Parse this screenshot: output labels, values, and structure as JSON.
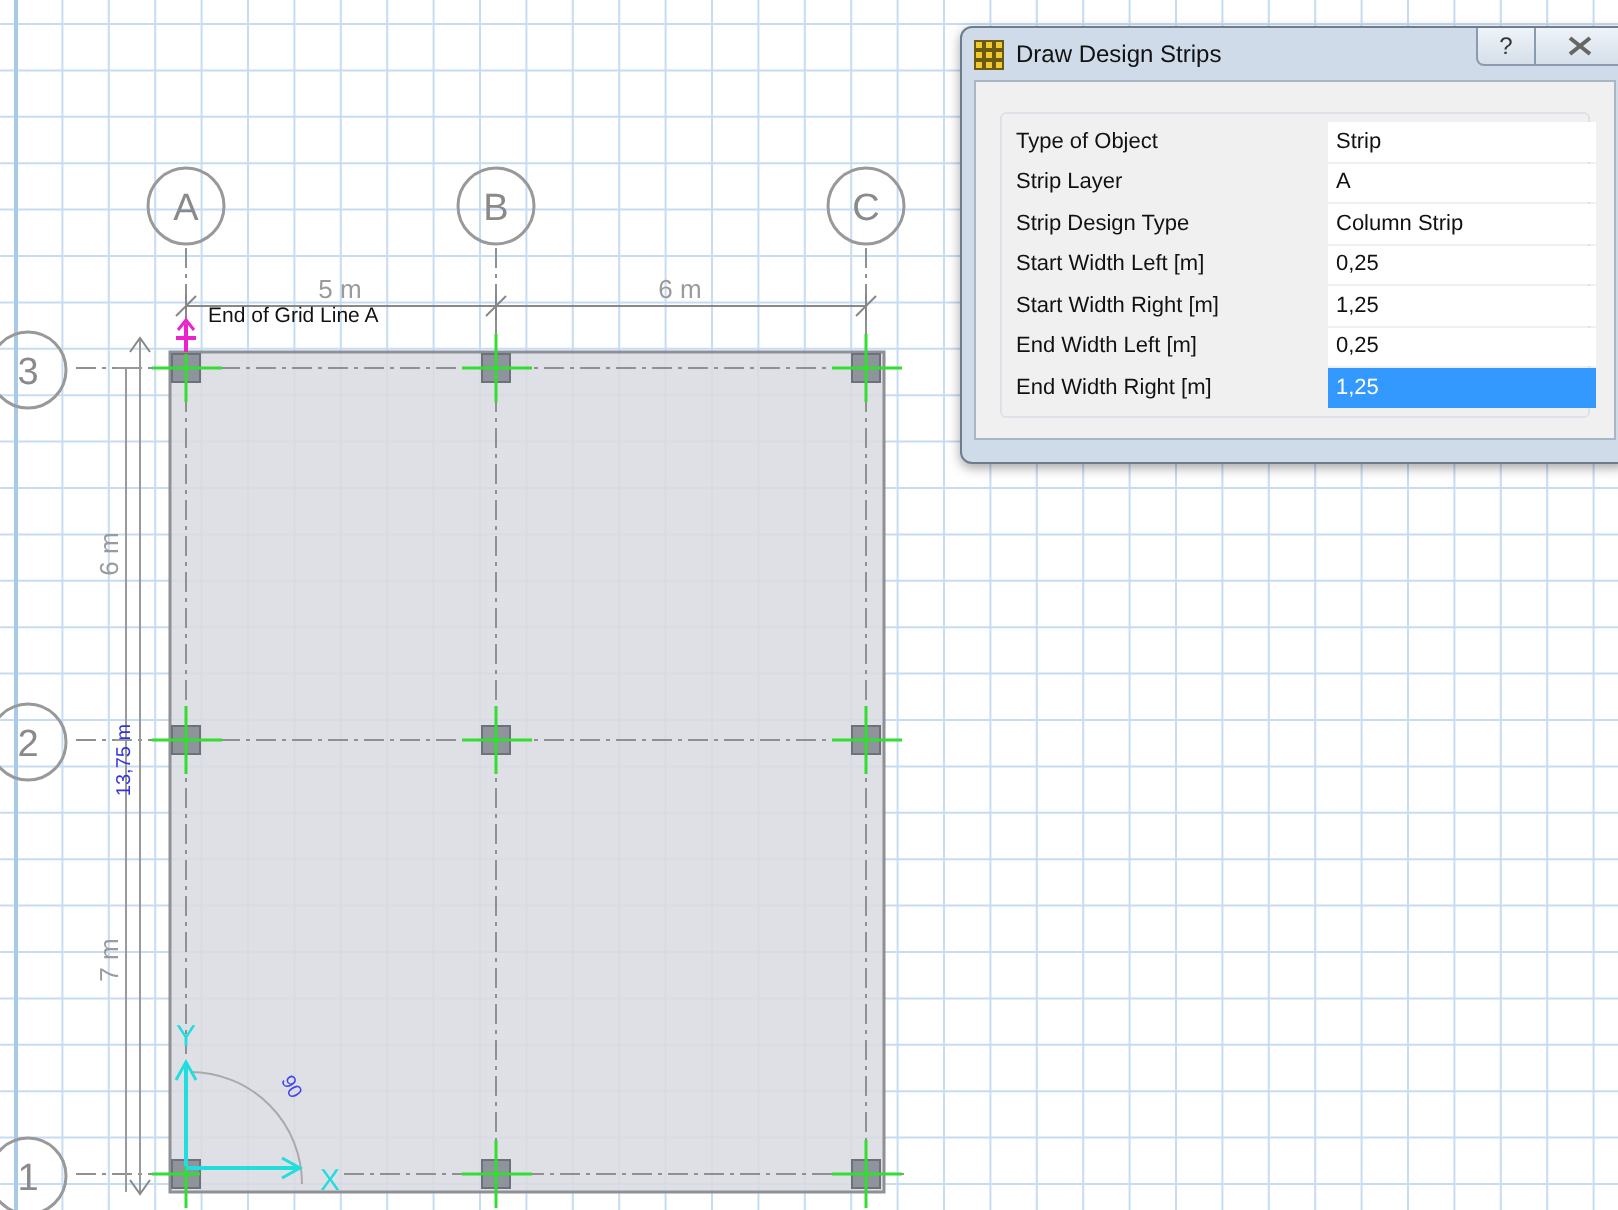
{
  "canvas": {
    "column_bubbles": [
      "A",
      "B",
      "C"
    ],
    "row_bubbles": [
      "3",
      "2",
      "1"
    ],
    "top_dimensions": [
      "5 m",
      "6 m"
    ],
    "left_dimensions": [
      "6 m",
      "7 m"
    ],
    "total_dimension": "13,75 m",
    "annotation": "End of Grid Line  A",
    "axes": {
      "x_label": "X",
      "y_label": "Y",
      "angle": "90"
    }
  },
  "dialog": {
    "title": "Draw Design Strips",
    "help": "?",
    "rows": [
      {
        "label": "Type of Object",
        "value": "Strip",
        "selected": false
      },
      {
        "label": "Strip Layer",
        "value": "A",
        "selected": false
      },
      {
        "label": "Strip Design Type",
        "value": "Column Strip",
        "selected": false
      },
      {
        "label": "Start Width Left  [m]",
        "value": "0,25",
        "selected": false
      },
      {
        "label": "Start Width Right  [m]",
        "value": "1,25",
        "selected": false
      },
      {
        "label": "End Width Left  [m]",
        "value": "0,25",
        "selected": false
      },
      {
        "label": "End Width Right  [m]",
        "value": "1,25",
        "selected": true
      }
    ]
  }
}
